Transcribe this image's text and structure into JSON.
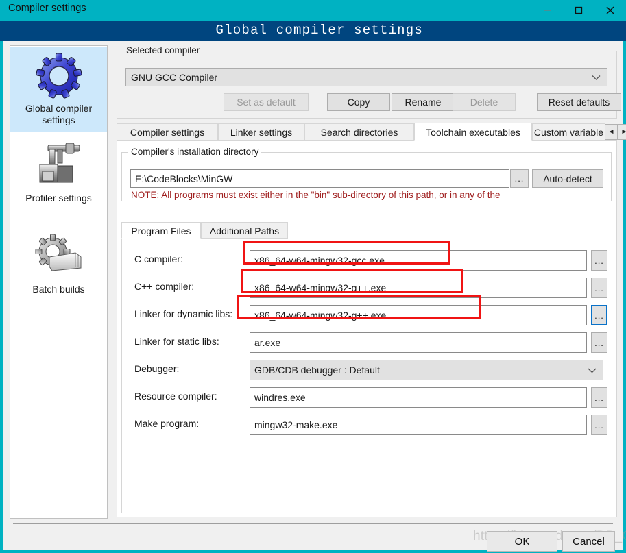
{
  "window": {
    "caption": "Compiler settings",
    "banner_title": "Global compiler settings",
    "accent_teal": "#00b2c2",
    "accent_banner": "#00457f",
    "minimize": "–",
    "maximize": "□",
    "close": "✕"
  },
  "sidebar": {
    "items": [
      {
        "label": "Global compiler\nsettings",
        "label_line1": "Global compiler",
        "label_line2": "settings",
        "icon": "gear-blue-icon",
        "selected": true
      },
      {
        "label": "Profiler settings",
        "label_line1": "Profiler settings",
        "label_line2": "",
        "icon": "caliper-icon",
        "selected": false
      },
      {
        "label": "Batch builds",
        "label_line1": "Batch builds",
        "label_line2": "",
        "icon": "gear-stack-icon",
        "selected": false
      }
    ]
  },
  "selected_compiler": {
    "group_title": "Selected compiler",
    "value": "GNU GCC Compiler",
    "dropdown_caret": "chevron-down-icon",
    "buttons": [
      {
        "label": "Set as default",
        "disabled": true
      },
      {
        "label": "Copy",
        "disabled": false
      },
      {
        "label": "Rename",
        "disabled": false
      },
      {
        "label": "Delete",
        "disabled": true
      },
      {
        "label": "Reset defaults",
        "disabled": false
      }
    ]
  },
  "tabs": {
    "items": [
      {
        "label": "Compiler settings",
        "active": false
      },
      {
        "label": "Linker settings",
        "active": false
      },
      {
        "label": "Search directories",
        "active": false
      },
      {
        "label": "Toolchain executables",
        "active": true
      },
      {
        "label": "Custom variable",
        "active": false
      }
    ],
    "scroll_left": "◄",
    "scroll_right": "►"
  },
  "install_dir": {
    "group_title": "Compiler's installation directory",
    "path": "E:\\CodeBlocks\\MinGW",
    "browse_label": "...",
    "autodetect_label": "Auto-detect",
    "note": "NOTE: All programs must exist either in the \"bin\" sub-directory of this path, or in any of the",
    "note_color": "#a02020"
  },
  "subtabs": {
    "items": [
      {
        "label": "Program Files",
        "active": true
      },
      {
        "label": "Additional Paths",
        "active": false
      }
    ]
  },
  "program_files": {
    "browse_label": "...",
    "dropdown_caret": "chevron-down-icon",
    "rows": [
      {
        "label": "C compiler:",
        "value": "x86_64-w64-mingw32-gcc.exe",
        "kind": "text",
        "highlighted": true,
        "focus": false
      },
      {
        "label": "C++ compiler:",
        "value": "x86_64-w64-mingw32-g++.exe",
        "kind": "text",
        "highlighted": true,
        "focus": false
      },
      {
        "label": "Linker for dynamic libs:",
        "value": "x86_64-w64-mingw32-g++.exe",
        "kind": "text",
        "highlighted": true,
        "focus": true
      },
      {
        "label": "Linker for static libs:",
        "value": "ar.exe",
        "kind": "text",
        "highlighted": false,
        "focus": false
      },
      {
        "label": "Debugger:",
        "value": "GDB/CDB debugger : Default",
        "kind": "select",
        "highlighted": false,
        "focus": false
      },
      {
        "label": "Resource compiler:",
        "value": "windres.exe",
        "kind": "text",
        "highlighted": false,
        "focus": false
      },
      {
        "label": "Make program:",
        "value": "mingw32-make.exe",
        "kind": "text",
        "highlighted": false,
        "focus": false
      }
    ]
  },
  "footer": {
    "ok_label": "OK",
    "cancel_label": "Cancel",
    "watermark": "https://blog.csdn.net/DB_GNE"
  },
  "annotations": {
    "color": "#f01414",
    "boxes": [
      {
        "name": "c-compiler-highlight"
      },
      {
        "name": "cpp-compiler-highlight"
      },
      {
        "name": "dynamic-linker-highlight"
      }
    ]
  }
}
